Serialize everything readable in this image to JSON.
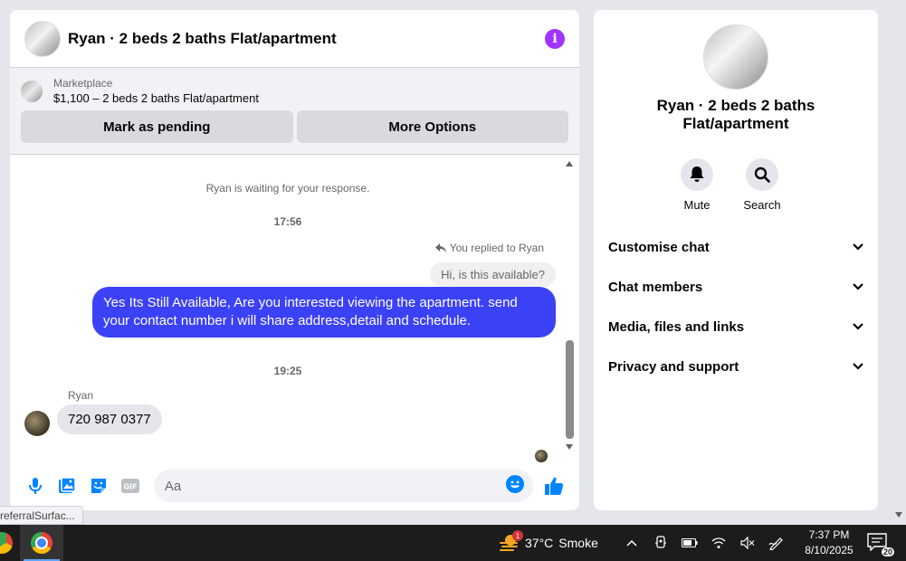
{
  "chat": {
    "title": "Ryan · 2 beds 2 baths Flat/apartment",
    "info_icon": "info-icon"
  },
  "marketplace": {
    "label": "Marketplace",
    "listing": "$1,100 – 2 beds 2 baths Flat/apartment",
    "mark_pending_label": "Mark as pending",
    "more_options_label": "More Options"
  },
  "messages": {
    "waiting_notice": "Ryan is waiting for your response.",
    "time_1": "17:56",
    "replied_label": "You replied to Ryan",
    "replied_to_text": "Hi, is this available?",
    "outgoing_text": "Yes Its Still Available, Are you interested viewing the apartment. send your contact number i will share address,detail and schedule.",
    "time_2": "19:25",
    "incoming_sender": "Ryan",
    "incoming_text": "720 987 0377"
  },
  "composer": {
    "placeholder": "Aa",
    "icons": [
      "microphone-icon",
      "photo-icon",
      "sticker-icon",
      "gif-icon",
      "emoji-icon",
      "thumbs-up-icon"
    ]
  },
  "details": {
    "title": "Ryan · 2 beds 2 baths Flat/apartment",
    "mute_label": "Mute",
    "search_label": "Search",
    "sections": [
      {
        "label": "Customise chat"
      },
      {
        "label": "Chat members"
      },
      {
        "label": "Media, files and links"
      },
      {
        "label": "Privacy and support"
      }
    ]
  },
  "status_tip": "referralSurfac...",
  "taskbar": {
    "weather_temp": "37°C",
    "weather_desc": "Smoke",
    "weather_badge": "1",
    "time": "7:37 PM",
    "date": "8/10/2025",
    "notification_count": "20"
  },
  "colors": {
    "accent": "#3b41f5",
    "info": "#a033ff",
    "messenger_blue": "#0084ff"
  }
}
